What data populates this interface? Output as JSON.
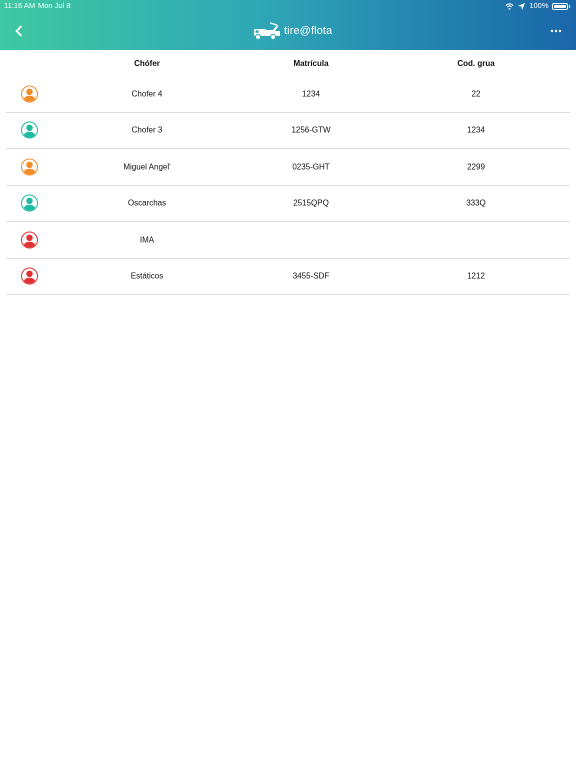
{
  "status_bar": {
    "time": "11:16 AM",
    "date": "Mon Jul 8",
    "battery": "100%"
  },
  "header": {
    "back_icon": "chevron-left-icon",
    "brand_logo": "tow-truck-logo",
    "brand_text": "tire@flota",
    "more_icon": "ellipsis-icon"
  },
  "colors": {
    "header_gradient": [
      "#3fc8a1",
      "#2fa7b6",
      "#1a66a9"
    ],
    "orange": "#f28c28",
    "teal": "#20b9a2",
    "red": "#e03232"
  },
  "table": {
    "columns": [
      "Chófer",
      "Matrícula",
      "Cod. grua"
    ],
    "rows": [
      {
        "avatar_color": "orange",
        "chofer": "Chofer 4",
        "matricula": "1234",
        "cod_grua": "22"
      },
      {
        "avatar_color": "teal",
        "chofer": "Chofer 3",
        "matricula": "1256-GTW",
        "cod_grua": "1234"
      },
      {
        "avatar_color": "orange",
        "chofer": "Miguel Angel'",
        "matricula": "0235-GHT",
        "cod_grua": "2299"
      },
      {
        "avatar_color": "teal",
        "chofer": "Oscarchas",
        "matricula": "2515QPQ",
        "cod_grua": "333Q"
      },
      {
        "avatar_color": "red",
        "chofer": "IMA",
        "matricula": "",
        "cod_grua": ""
      },
      {
        "avatar_color": "red",
        "chofer": "Estáticos",
        "matricula": "3455-SDF",
        "cod_grua": "1212"
      }
    ]
  }
}
